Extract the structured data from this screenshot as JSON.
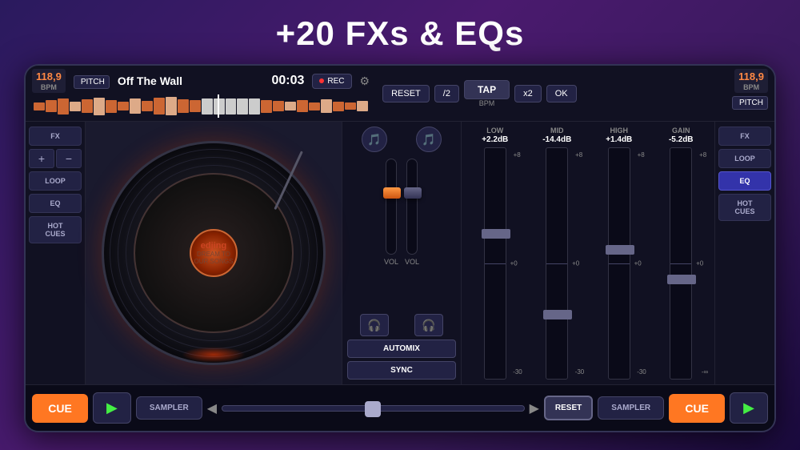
{
  "page": {
    "title": "+20 FXs & EQs"
  },
  "top_bar": {
    "left": {
      "bpm": "118,9",
      "bpm_label": "BPM",
      "track_name": "Off The Wall",
      "time": "00:03",
      "rec": "REC",
      "pitch": "PITCH"
    },
    "center": {
      "reset": "RESET",
      "divider": "/2",
      "tap": "TAP",
      "tap_label": "BPM",
      "x2": "x2",
      "ok": "OK"
    },
    "right": {
      "bpm": "118,9",
      "bpm_label": "BPM",
      "pitch": "PITCH"
    }
  },
  "left_panel": {
    "fx": "FX",
    "add": "+",
    "minus": "−",
    "loop": "LOOP",
    "eq": "EQ",
    "hot_cues_line1": "HOT",
    "hot_cues_line2": "CUES"
  },
  "right_panel": {
    "fx": "FX",
    "loop": "LOOP",
    "eq": "EQ",
    "hot_cues_line1": "HOT",
    "hot_cues_line2": "CUES"
  },
  "turntable": {
    "label": "edjing",
    "sublabel": "DREAM TO OUR SONGS"
  },
  "eq": {
    "low_label": "LOW",
    "low_value": "+2.2dB",
    "mid_label": "MID",
    "mid_value": "-14.4dB",
    "high_label": "HIGH",
    "high_value": "+1.4dB",
    "gain_label": "GAIN",
    "gain_value": "-5.2dB",
    "plus8": "+8",
    "zero": "+0",
    "minus30": "-30"
  },
  "mixer": {
    "automix": "AUTOMIX",
    "sync": "SYNC",
    "vol1": "VOL",
    "vol2": "VOL"
  },
  "bottom_bar": {
    "cue_left": "CUE",
    "play_left": "▶",
    "sampler_left": "SAMPLER",
    "arrow_left": "◀",
    "arrow_right": "▶",
    "reset": "RESET",
    "sampler_right": "SAMPLER",
    "cue_right": "CUE",
    "play_right": "▶"
  }
}
